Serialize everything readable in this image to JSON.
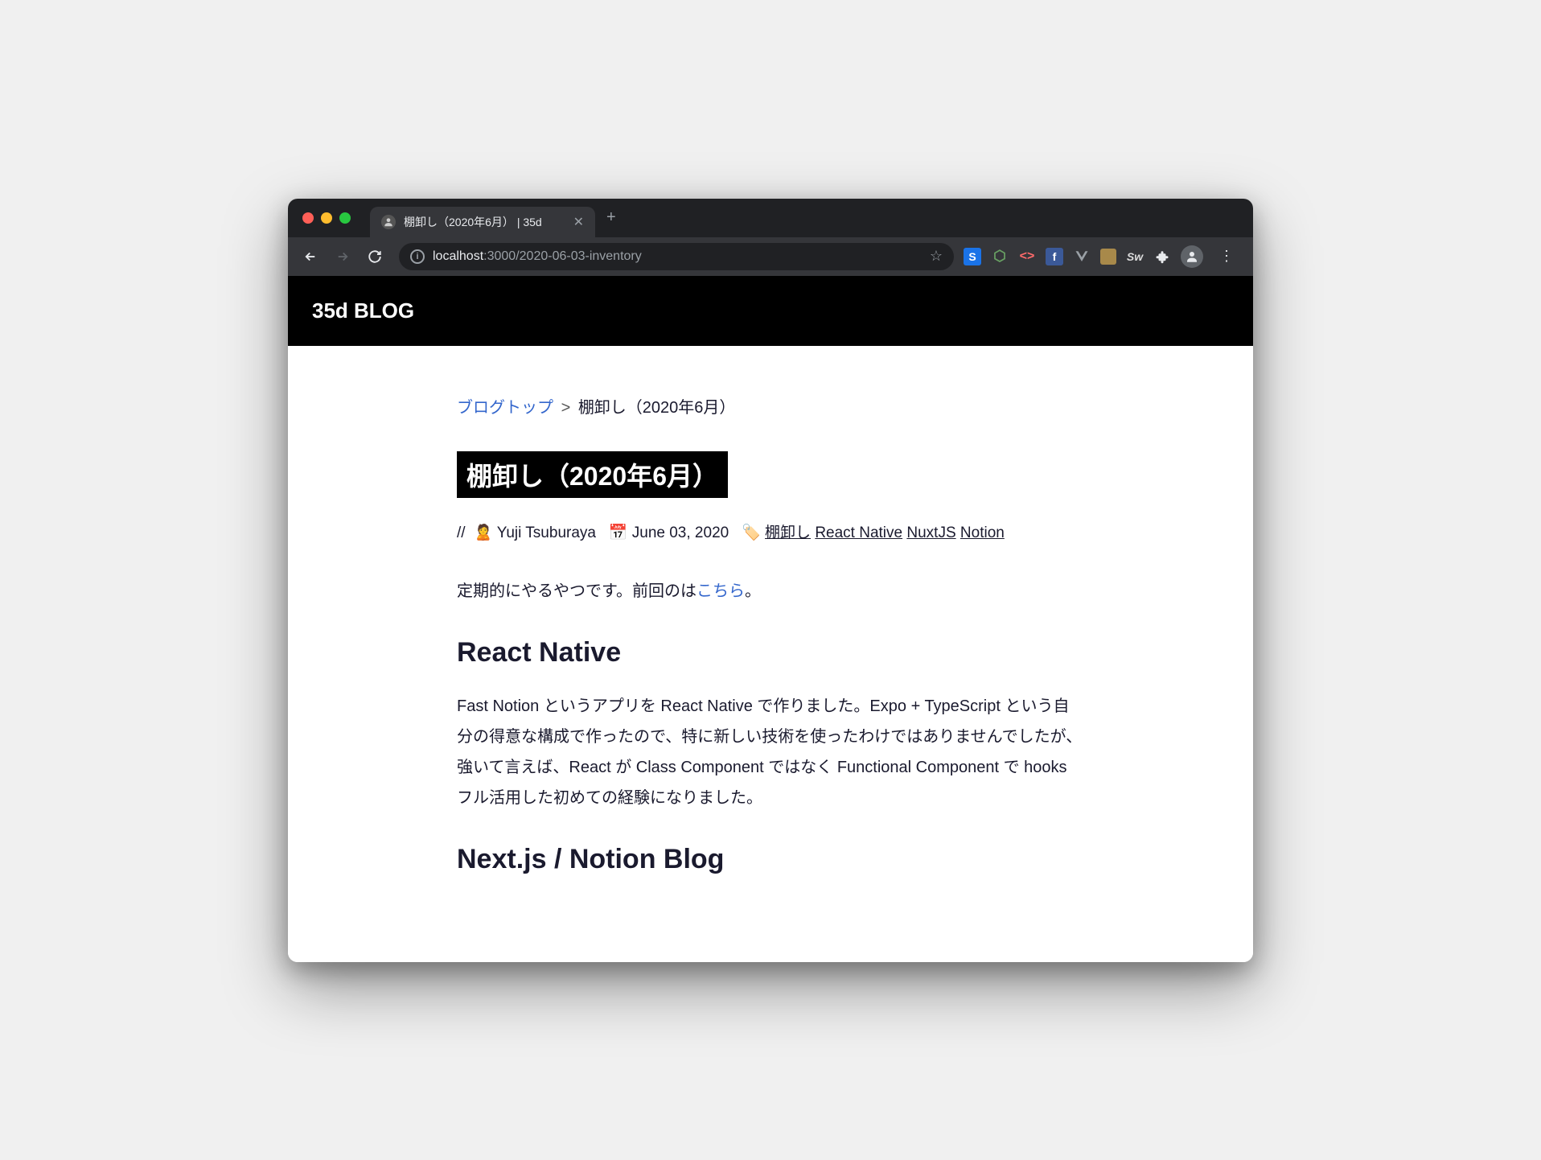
{
  "browser": {
    "tab_title": "棚卸し（2020年6月） | 35d",
    "url": {
      "host": "localhost",
      "port_path": ":3000/2020-06-03-inventory"
    },
    "extensions": [
      "S",
      "⬢",
      "<>",
      "f",
      "V",
      "▣",
      "Sw",
      "✦"
    ]
  },
  "site": {
    "header_title": "35d BLOG"
  },
  "breadcrumb": {
    "home_label": "ブログトップ",
    "sep": ">",
    "current": "棚卸し（2020年6月）"
  },
  "post": {
    "title": "棚卸し（2020年6月）",
    "meta_prefix": "//",
    "author_emoji": "🙎",
    "author": "Yuji Tsuburaya",
    "date_emoji": "📅",
    "date": "June 03, 2020",
    "tag_emoji": "🏷️",
    "tags": [
      "棚卸し",
      "React Native",
      "NuxtJS",
      "Notion"
    ]
  },
  "body": {
    "intro_before": "定期的にやるやつです。前回のは",
    "intro_link": "こちら",
    "intro_after": "。",
    "h2_1": "React Native",
    "p1": "Fast Notion というアプリを React Native で作りました。Expo + TypeScript という自分の得意な構成で作ったので、特に新しい技術を使ったわけではありませんでしたが、強いて言えば、React が Class Component ではなく Functional Component で hooks フル活用した初めての経験になりました。",
    "h2_2": "Next.js / Notion Blog"
  }
}
